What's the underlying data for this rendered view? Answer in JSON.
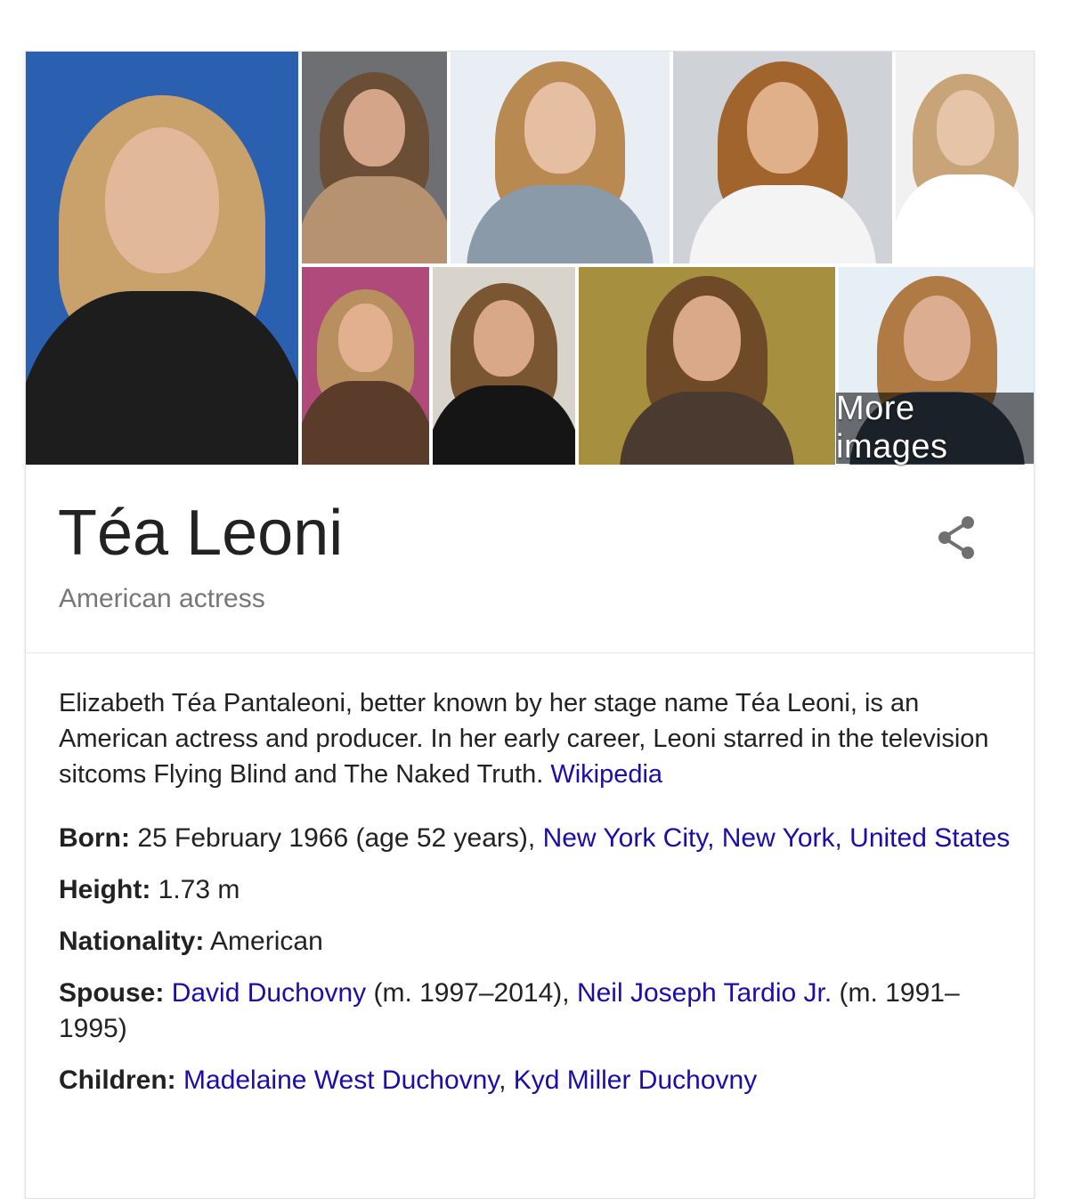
{
  "gallery": {
    "more_images_label": "More images",
    "images": [
      {
        "name": "photo-portrait-main",
        "bg": "#2b5fb0",
        "hair": "#c9a16a",
        "skin": "#e2b89a",
        "cloth": "#1d1d1d"
      },
      {
        "name": "photo-tan-jacket",
        "bg": "#6d6f72",
        "hair": "#6a4e35",
        "skin": "#d4a588",
        "cloth": "#b69270"
      },
      {
        "name": "photo-hand-on-face",
        "bg": "#e8eef4",
        "hair": "#b88a52",
        "skin": "#e6bfa2",
        "cloth": "#8a9aa8"
      },
      {
        "name": "photo-laughing",
        "bg": "#cfd3d8",
        "hair": "#a0642c",
        "skin": "#e0b08a",
        "cloth": "#f4f4f4"
      },
      {
        "name": "photo-white-dress-seated",
        "bg": "#f1f1f1",
        "hair": "#c8a478",
        "skin": "#e6c4a8",
        "cloth": "#ffffff"
      },
      {
        "name": "photo-brown-dress",
        "bg": "#b04a7a",
        "hair": "#b89060",
        "skin": "#e2b08e",
        "cloth": "#5b3b2a"
      },
      {
        "name": "photo-black-dress-seated",
        "bg": "#d8d4cc",
        "hair": "#7a5632",
        "skin": "#d8a888",
        "cloth": "#151515"
      },
      {
        "name": "photo-short-hair-smile",
        "bg": "#a68f3f",
        "hair": "#6e4a28",
        "skin": "#d9a989",
        "cloth": "#4a3a30"
      },
      {
        "name": "photo-closeup-blue",
        "bg": "#e6eef6",
        "hair": "#b07a44",
        "skin": "#dcad90",
        "cloth": "#3a4a5a"
      }
    ]
  },
  "entity": {
    "title": "Téa Leoni",
    "subtitle": "American actress",
    "share_icon": "share-icon"
  },
  "description": {
    "text": "Elizabeth Téa Pantaleoni, better known by her stage name Téa Leoni, is an American actress and producer. In her early career, Leoni starred in the television sitcoms Flying Blind and The Naked Truth. ",
    "source_link": "Wikipedia"
  },
  "facts": {
    "born": {
      "label": "Born:",
      "value": " 25 February 1966 (age 52 years), ",
      "link": "New York City, New York, United States"
    },
    "height": {
      "label": "Height:",
      "value": " 1.73 m"
    },
    "nationality": {
      "label": "Nationality:",
      "value": " American"
    },
    "spouse": {
      "label": "Spouse:",
      "link1": "David Duchovny",
      "text1": " (m. 1997–2014), ",
      "link2": "Neil Joseph Tardio Jr.",
      "text2": " (m. 1991–1995)"
    },
    "children": {
      "label": "Children:",
      "link1": "Madelaine West Duchovny",
      "sep": ", ",
      "link2": "Kyd Miller Duchovny"
    }
  },
  "colors": {
    "link": "#1a0dab",
    "text": "#222222",
    "muted": "#777777"
  }
}
